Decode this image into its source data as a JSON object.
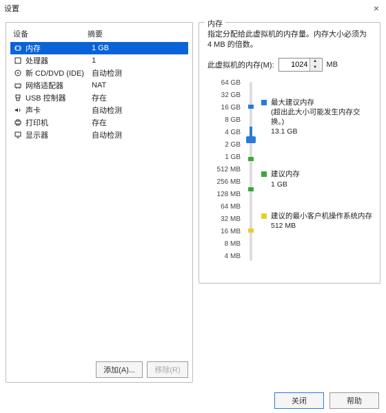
{
  "title": "设置",
  "left": {
    "col_device": "设备",
    "col_summary": "摘要",
    "devices": [
      {
        "icon": "chip",
        "name": "内存",
        "summary": "1 GB",
        "selected": true
      },
      {
        "icon": "cpu",
        "name": "处理器",
        "summary": "1"
      },
      {
        "icon": "disc",
        "name": "新 CD/DVD (IDE)",
        "summary": "自动检测"
      },
      {
        "icon": "nic",
        "name": "网络适配器",
        "summary": "NAT"
      },
      {
        "icon": "usb",
        "name": "USB 控制器",
        "summary": "存在"
      },
      {
        "icon": "sound",
        "name": "声卡",
        "summary": "自动检测"
      },
      {
        "icon": "printer",
        "name": "打印机",
        "summary": "存在"
      },
      {
        "icon": "display",
        "name": "显示器",
        "summary": "自动检测"
      }
    ],
    "add_btn": "添加(A)...",
    "remove_btn": "移除(R)"
  },
  "right": {
    "legend": "内存",
    "desc": "指定分配给此虚拟机的内存量。内存大小必须为 4 MB 的倍数。",
    "input_label": "此虚拟机的内存(M):",
    "input_value": "1024",
    "input_unit": "MB",
    "scale": [
      "64 GB",
      "32 GB",
      "16 GB",
      "8 GB",
      "4 GB",
      "2 GB",
      "1 GB",
      "512 MB",
      "256 MB",
      "128 MB",
      "64 MB",
      "32 MB",
      "16 MB",
      "8 MB",
      "4 MB"
    ],
    "legend_items": [
      {
        "color": "blue",
        "title": "最大建议内存",
        "sub": "(超出此大小可能发生内存交换。)",
        "val": "13.1 GB"
      },
      {
        "color": "green",
        "title": "建议内存",
        "sub": "",
        "val": "1 GB"
      },
      {
        "color": "yellow",
        "title": "建议的最小客户机操作系统内存",
        "sub": "",
        "val": "512 MB"
      }
    ]
  },
  "footer": {
    "close": "关闭",
    "help": "帮助"
  }
}
